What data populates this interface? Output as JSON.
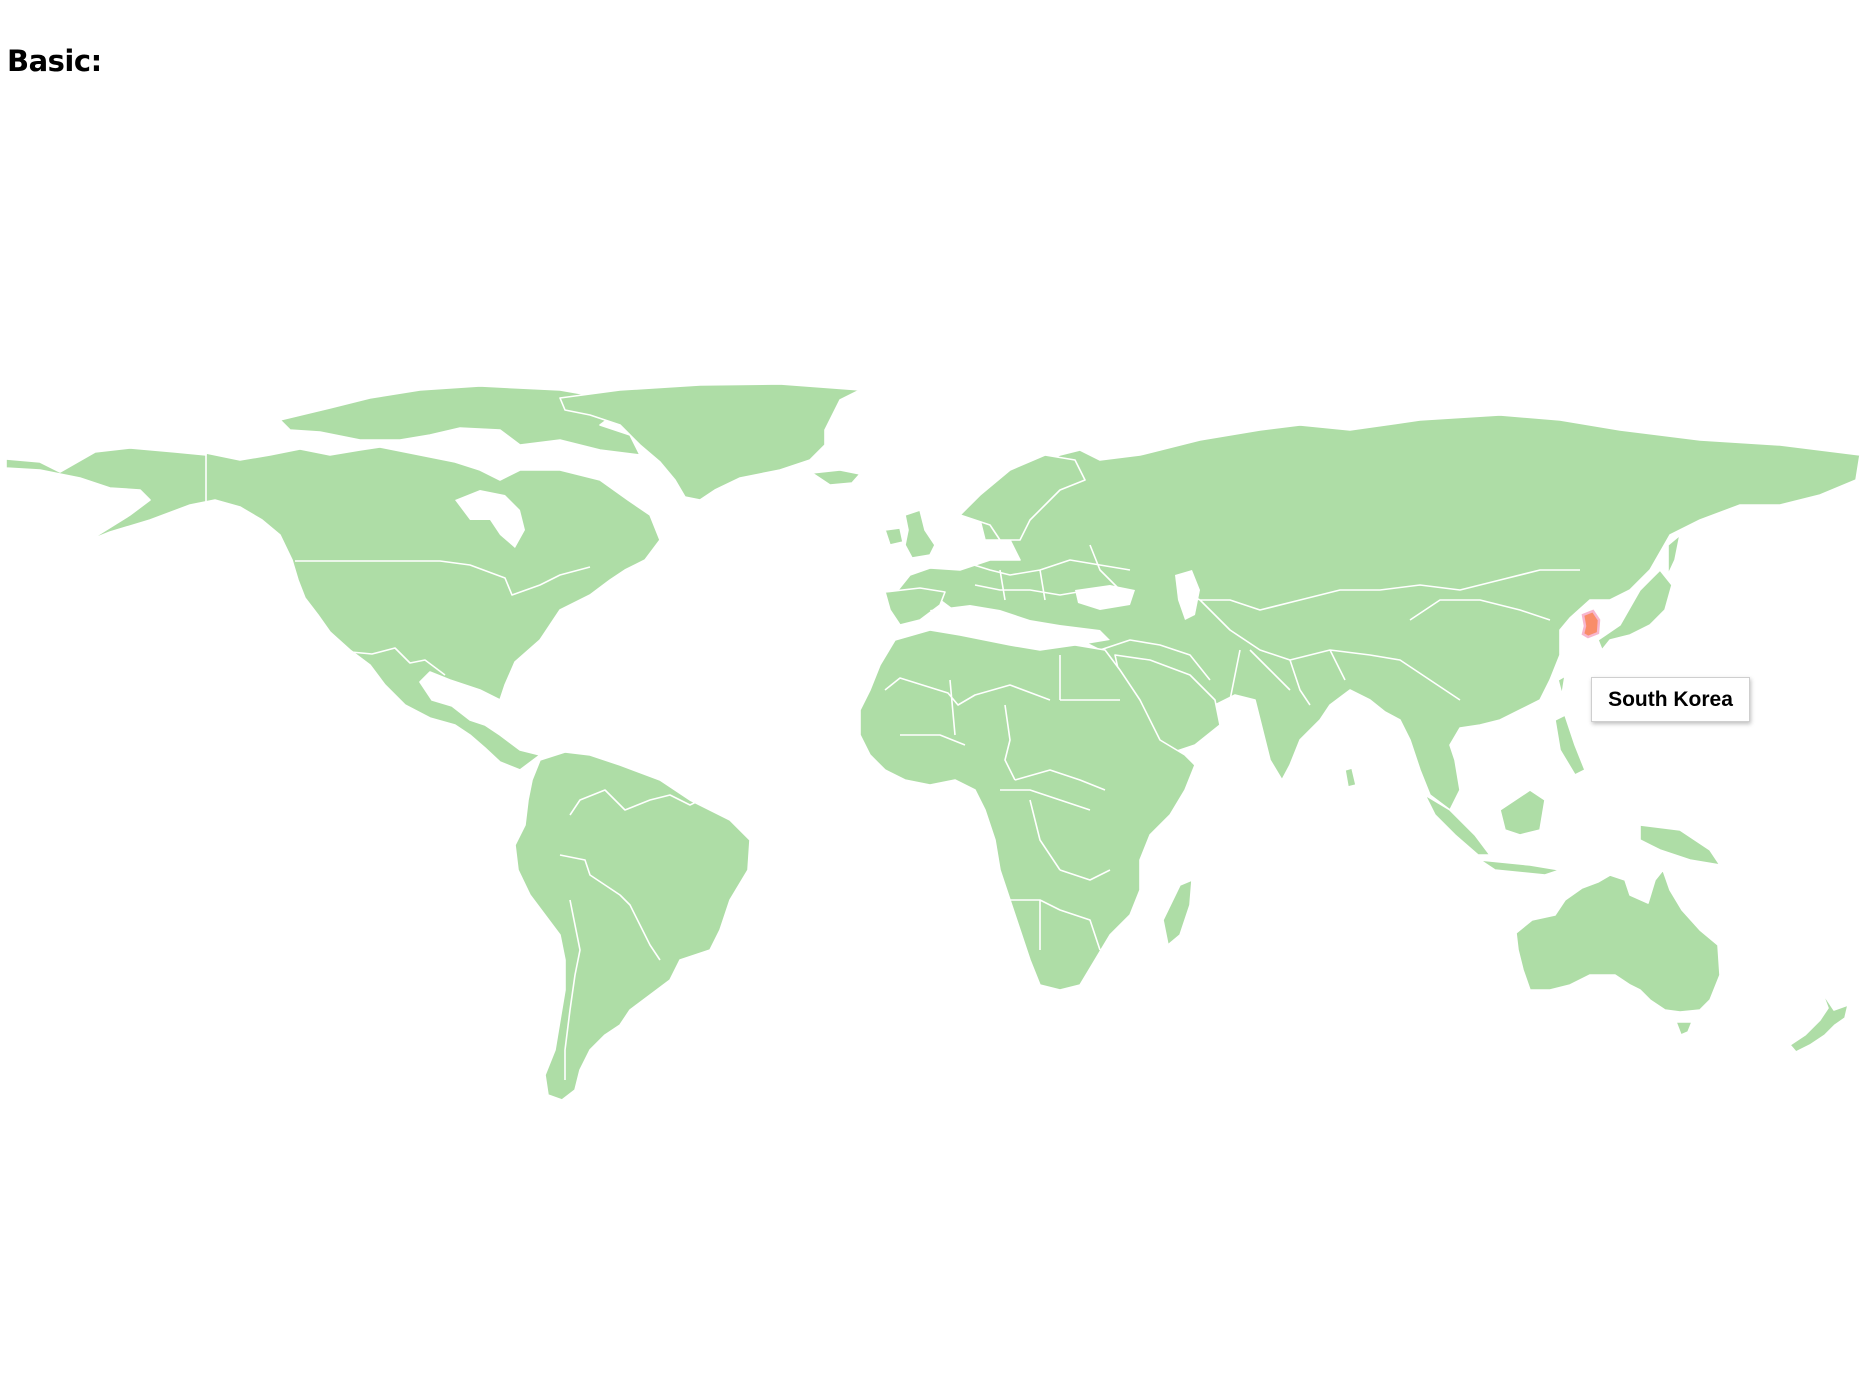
{
  "page": {
    "heading": "Basic:"
  },
  "map": {
    "projection": "equirectangular",
    "default_fill": "#aedda6",
    "border_color": "#ffffff",
    "highlight_fill": "#f98d6a",
    "highlight_stroke": "#f7b6cf",
    "regions": [
      {
        "id": "north-america",
        "label": "North America"
      },
      {
        "id": "greenland",
        "label": "Greenland"
      },
      {
        "id": "south-america",
        "label": "South America"
      },
      {
        "id": "europe-asia",
        "label": "Eurasia"
      },
      {
        "id": "africa",
        "label": "Africa"
      },
      {
        "id": "australia",
        "label": "Australia"
      },
      {
        "id": "new-zealand",
        "label": "New Zealand"
      },
      {
        "id": "japan",
        "label": "Japan"
      },
      {
        "id": "south-korea",
        "label": "South Korea"
      }
    ],
    "hovered_country": "South Korea"
  },
  "tooltip": {
    "text": "South Korea"
  }
}
